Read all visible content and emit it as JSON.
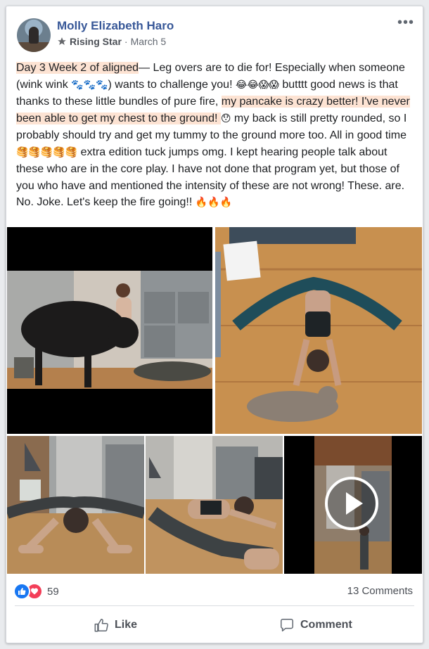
{
  "post": {
    "author_name": "Molly Elizabeth Haro",
    "badge": "Rising Star",
    "separator": "·",
    "date": "March 5",
    "more_label": "•••",
    "text": {
      "t1": "Day 3 Week 2 of aligned",
      "t2": "— Leg overs are to die for! Especially when someone (wink wink ",
      "paws": "🐾🐾🐾",
      "t3": ") wants to challenge you! ",
      "faces": "😂😂😱😱",
      "t4": " butttt good news is that thanks to these little bundles of pure fire, ",
      "t5": "my pancake is crazy better! I've never been able to get my chest to the ground! ",
      "shock": "😯",
      "t6": " my back is still pretty rounded, so I probably should try and get my tummy to the ground more too. All in good time ",
      "pancakes": "🥞🥞🥞🥞🥞",
      "t7": " extra edition tuck jumps omg. I kept hearing people talk about these who are in the core play. I have not done that program yet, but those of you who have and mentioned the intensity of these are not wrong! These. are. No. Joke. Let's keep the fire going!! ",
      "fires": "🔥🔥🔥"
    }
  },
  "footer": {
    "reaction_count": "59",
    "comments_label": "13 Comments",
    "like_label": "Like",
    "comment_label": "Comment"
  },
  "colors": {
    "name_blue": "#385898",
    "highlight": "#fde3d3",
    "like_blue": "#1877f2",
    "love_red": "#f33e58"
  },
  "icons": [
    "star-icon",
    "like-icon",
    "love-icon",
    "thumbs-up-icon",
    "comment-bubble-icon",
    "play-icon"
  ]
}
